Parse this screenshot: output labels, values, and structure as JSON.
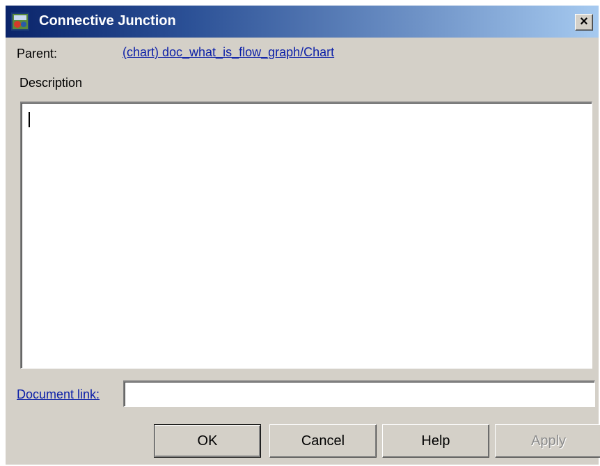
{
  "window": {
    "title": "Connective Junction",
    "close_label": "×"
  },
  "parent": {
    "label": "Parent:",
    "link": "(chart) doc_what_is_flow_graph/Chart"
  },
  "description": {
    "label": "Description",
    "value": ""
  },
  "document_link": {
    "label": "Document link:",
    "value": ""
  },
  "buttons": {
    "ok": "OK",
    "cancel": "Cancel",
    "help": "Help",
    "apply": "Apply"
  },
  "colors": {
    "titlebar_start": "#0a246a",
    "titlebar_end": "#a6caf0",
    "dialog_bg": "#d4d0c8",
    "link": "#0b1fa8"
  },
  "icons": {
    "app": "stateflow-app-icon",
    "close": "close-icon"
  }
}
